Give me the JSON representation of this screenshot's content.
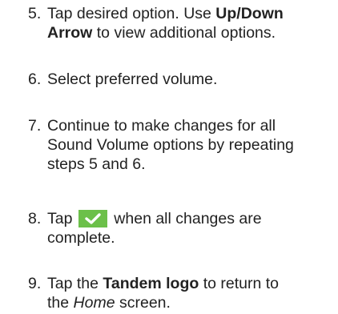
{
  "steps": [
    {
      "number": "5.",
      "line1_a": "Tap desired option. Use ",
      "line1_b": "Up/Down",
      "line2_a": "Arrow",
      "line2_b": " to view additional options."
    },
    {
      "number": "6.",
      "text": "Select preferred volume."
    },
    {
      "number": "7.",
      "line1": "Continue to make changes for all",
      "line2": "Sound Volume options by repeating",
      "line3": "steps 5 and 6."
    },
    {
      "number": "8.",
      "line1_a": "Tap",
      "line1_b": "when all changes are",
      "line2": "complete."
    },
    {
      "number": "9.",
      "line1_a": "Tap the ",
      "line1_b": "Tandem logo",
      "line1_c": " to return to",
      "line2_a": "the ",
      "line2_b": "Home",
      "line2_c": " screen."
    }
  ],
  "icons": {
    "save_button_icon": "checkmark-icon",
    "save_button_color": "#6cc04a"
  }
}
